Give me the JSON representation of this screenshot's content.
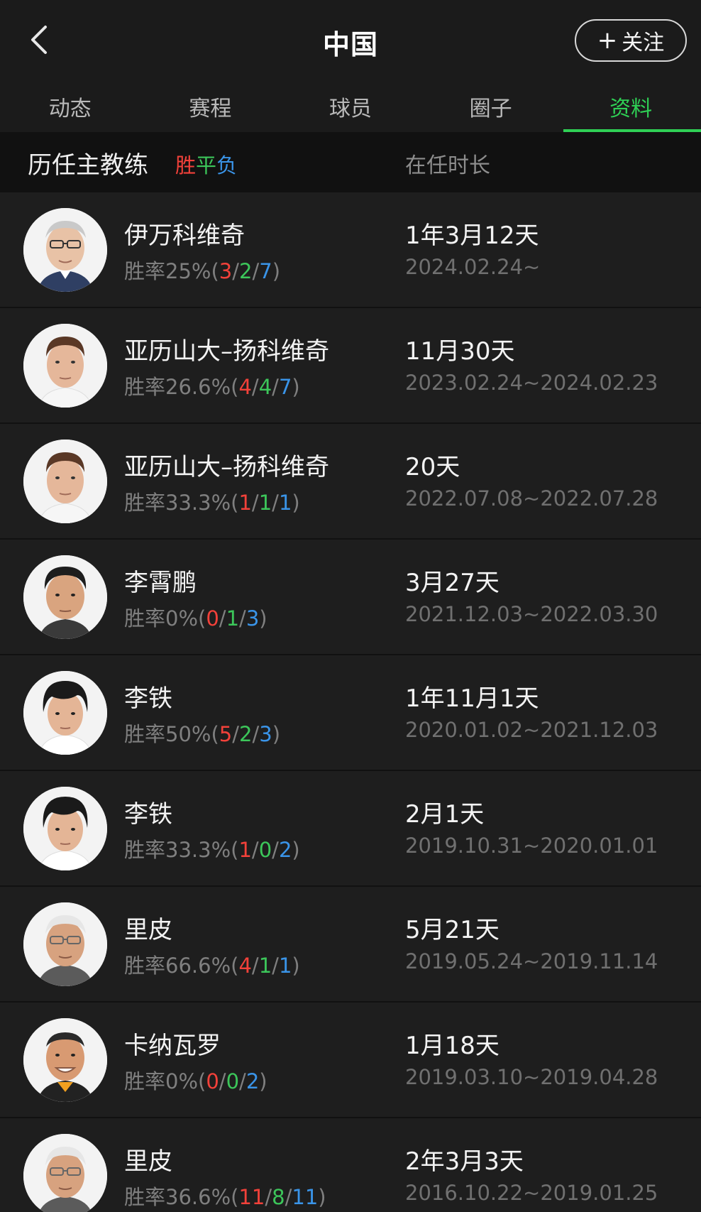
{
  "header": {
    "title": "中国",
    "follow_plus": "+",
    "follow_label": "关注"
  },
  "tabs": [
    {
      "label": "动态",
      "active": false
    },
    {
      "label": "赛程",
      "active": false
    },
    {
      "label": "球员",
      "active": false
    },
    {
      "label": "圈子",
      "active": false
    },
    {
      "label": "资料",
      "active": true
    }
  ],
  "section": {
    "title": "历任主教练",
    "legend_win": "胜",
    "legend_draw": "平",
    "legend_loss": "负",
    "column_header": "在任时长"
  },
  "colors": {
    "accent": "#2fd055",
    "win": "#f2413a",
    "draw": "#3cc65a",
    "loss": "#3a94e8"
  },
  "coaches": [
    {
      "name": "伊万科维奇",
      "rate_label": "胜率25%",
      "w": "3",
      "d": "2",
      "l": "7",
      "tenure": "1年3月12天",
      "period": "2024.02.24~"
    },
    {
      "name": "亚历山大–扬科维奇",
      "rate_label": "胜率26.6%",
      "w": "4",
      "d": "4",
      "l": "7",
      "tenure": "11月30天",
      "period": "2023.02.24~2024.02.23"
    },
    {
      "name": "亚历山大–扬科维奇",
      "rate_label": "胜率33.3%",
      "w": "1",
      "d": "1",
      "l": "1",
      "tenure": "20天",
      "period": "2022.07.08~2022.07.28"
    },
    {
      "name": "李霄鹏",
      "rate_label": "胜率0%",
      "w": "0",
      "d": "1",
      "l": "3",
      "tenure": "3月27天",
      "period": "2021.12.03~2022.03.30"
    },
    {
      "name": "李铁",
      "rate_label": "胜率50%",
      "w": "5",
      "d": "2",
      "l": "3",
      "tenure": "1年11月1天",
      "period": "2020.01.02~2021.12.03"
    },
    {
      "name": "李铁",
      "rate_label": "胜率33.3%",
      "w": "1",
      "d": "0",
      "l": "2",
      "tenure": "2月1天",
      "period": "2019.10.31~2020.01.01"
    },
    {
      "name": "里皮",
      "rate_label": "胜率66.6%",
      "w": "4",
      "d": "1",
      "l": "1",
      "tenure": "5月21天",
      "period": "2019.05.24~2019.11.14"
    },
    {
      "name": "卡纳瓦罗",
      "rate_label": "胜率0%",
      "w": "0",
      "d": "0",
      "l": "2",
      "tenure": "1月18天",
      "period": "2019.03.10~2019.04.28"
    },
    {
      "name": "里皮",
      "rate_label": "胜率36.6%",
      "w": "11",
      "d": "8",
      "l": "11",
      "tenure": "2年3月3天",
      "period": "2016.10.22~2019.01.25"
    }
  ]
}
